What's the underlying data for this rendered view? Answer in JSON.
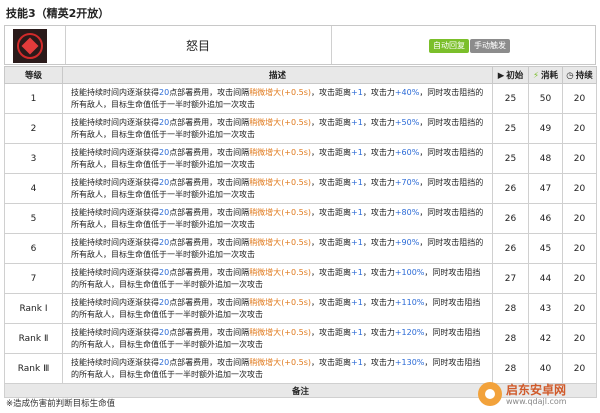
{
  "page_title": "技能3（精英2开放）",
  "skill": {
    "name": "怒目",
    "badges": [
      "自动回复",
      "手动触发"
    ]
  },
  "table": {
    "headers": {
      "level": "等级",
      "desc": "描述",
      "init": "初始",
      "cost": "消耗",
      "duration": "持续"
    },
    "rows": [
      {
        "level": "1",
        "pre": "技能持续时间内逐渐获得",
        "dp": "20",
        "mid1": "点部署费用，攻击间隔",
        "interval": "稍微增大",
        "iv": "(+0.5s)",
        "mid2": "，攻击距离",
        "range": "+1",
        "mid3": "，攻击力",
        "atk": "+40%",
        "mid4": "，同时攻击阻挡的所有敌人，目标生命值低于一半时额外追加一次攻击",
        "init": "25",
        "cost": "50",
        "dur": "20"
      },
      {
        "level": "2",
        "pre": "技能持续时间内逐渐获得",
        "dp": "20",
        "mid1": "点部署费用，攻击间隔",
        "interval": "稍微增大",
        "iv": "(+0.5s)",
        "mid2": "，攻击距离",
        "range": "+1",
        "mid3": "，攻击力",
        "atk": "+50%",
        "mid4": "，同时攻击阻挡的所有敌人，目标生命值低于一半时额外追加一次攻击",
        "init": "25",
        "cost": "49",
        "dur": "20"
      },
      {
        "level": "3",
        "pre": "技能持续时间内逐渐获得",
        "dp": "20",
        "mid1": "点部署费用，攻击间隔",
        "interval": "稍微增大",
        "iv": "(+0.5s)",
        "mid2": "，攻击距离",
        "range": "+1",
        "mid3": "，攻击力",
        "atk": "+60%",
        "mid4": "，同时攻击阻挡的所有敌人，目标生命值低于一半时额外追加一次攻击",
        "init": "25",
        "cost": "48",
        "dur": "20"
      },
      {
        "level": "4",
        "pre": "技能持续时间内逐渐获得",
        "dp": "20",
        "mid1": "点部署费用，攻击间隔",
        "interval": "稍微增大",
        "iv": "(+0.5s)",
        "mid2": "，攻击距离",
        "range": "+1",
        "mid3": "，攻击力",
        "atk": "+70%",
        "mid4": "，同时攻击阻挡的所有敌人，目标生命值低于一半时额外追加一次攻击",
        "init": "26",
        "cost": "47",
        "dur": "20"
      },
      {
        "level": "5",
        "pre": "技能持续时间内逐渐获得",
        "dp": "20",
        "mid1": "点部署费用，攻击间隔",
        "interval": "稍微增大",
        "iv": "(+0.5s)",
        "mid2": "，攻击距离",
        "range": "+1",
        "mid3": "，攻击力",
        "atk": "+80%",
        "mid4": "，同时攻击阻挡的所有敌人，目标生命值低于一半时额外追加一次攻击",
        "init": "26",
        "cost": "46",
        "dur": "20"
      },
      {
        "level": "6",
        "pre": "技能持续时间内逐渐获得",
        "dp": "20",
        "mid1": "点部署费用，攻击间隔",
        "interval": "稍微增大",
        "iv": "(+0.5s)",
        "mid2": "，攻击距离",
        "range": "+1",
        "mid3": "，攻击力",
        "atk": "+90%",
        "mid4": "，同时攻击阻挡的所有敌人，目标生命值低于一半时额外追加一次攻击",
        "init": "26",
        "cost": "45",
        "dur": "20"
      },
      {
        "level": "7",
        "pre": "技能持续时间内逐渐获得",
        "dp": "20",
        "mid1": "点部署费用，攻击间隔",
        "interval": "稍微增大",
        "iv": "(+0.5s)",
        "mid2": "，攻击距离",
        "range": "+1",
        "mid3": "，攻击力",
        "atk": "+100%",
        "mid4": "，同时攻击阻挡的所有敌人，目标生命值低于一半时额外追加一次攻击",
        "init": "27",
        "cost": "44",
        "dur": "20"
      },
      {
        "level": "Rank Ⅰ",
        "pre": "技能持续时间内逐渐获得",
        "dp": "20",
        "mid1": "点部署费用，攻击间隔",
        "interval": "稍微增大",
        "iv": "(+0.5s)",
        "mid2": "，攻击距离",
        "range": "+1",
        "mid3": "，攻击力",
        "atk": "+110%",
        "mid4": "，同时攻击阻挡的所有敌人，目标生命值低于一半时额外追加一次攻击",
        "init": "28",
        "cost": "43",
        "dur": "20"
      },
      {
        "level": "Rank Ⅱ",
        "pre": "技能持续时间内逐渐获得",
        "dp": "20",
        "mid1": "点部署费用，攻击间隔",
        "interval": "稍微增大",
        "iv": "(+0.5s)",
        "mid2": "，攻击距离",
        "range": "+1",
        "mid3": "，攻击力",
        "atk": "+120%",
        "mid4": "，同时攻击阻挡的所有敌人，目标生命值低于一半时额外追加一次攻击",
        "init": "28",
        "cost": "42",
        "dur": "20"
      },
      {
        "level": "Rank Ⅲ",
        "pre": "技能持续时间内逐渐获得",
        "dp": "20",
        "mid1": "点部署费用，攻击间隔",
        "interval": "稍微增大",
        "iv": "(+0.5s)",
        "mid2": "，攻击距离",
        "range": "+1",
        "mid3": "，攻击力",
        "atk": "+130%",
        "mid4": "，同时攻击阻挡的所有敌人，目标生命值低于一半时额外追加一次攻击",
        "init": "28",
        "cost": "40",
        "dur": "20"
      }
    ],
    "note_header": "备注",
    "note": "※造成伤害前判断目标生命值"
  },
  "watermark": {
    "line1": "启东安卓网",
    "line2": "www.qdajl.com"
  },
  "colors": {
    "highlight_blue": "#2a6ad6",
    "highlight_orange": "#e07b1f",
    "badge_green": "#7bbf2a",
    "badge_gray": "#8c8c8c"
  }
}
